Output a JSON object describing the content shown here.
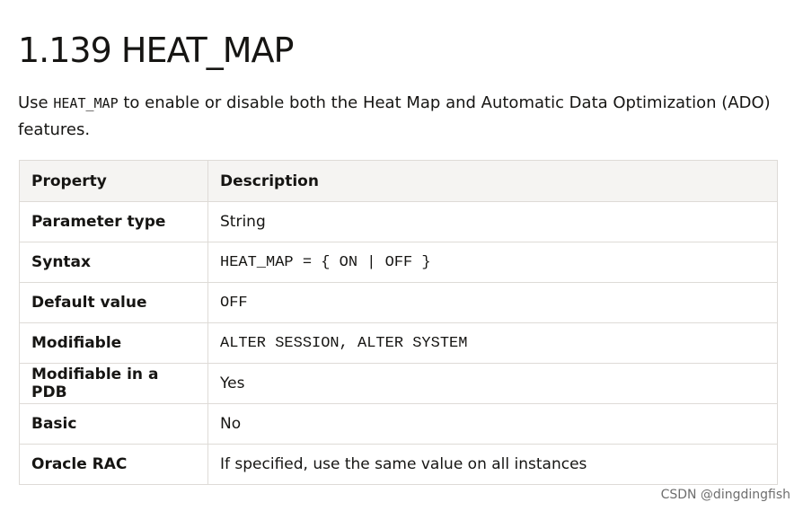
{
  "page_title": "1.139 HEAT_MAP",
  "intro": {
    "prefix": "Use ",
    "code": "HEAT_MAP",
    "suffix": " to enable or disable both the Heat Map and Automatic Data Optimization (ADO) features."
  },
  "table": {
    "headers": [
      "Property",
      "Description"
    ],
    "rows": [
      {
        "property": "Parameter type",
        "description": "String",
        "mono": false
      },
      {
        "property": "Syntax",
        "description": "HEAT_MAP = { ON | OFF }",
        "mono": true
      },
      {
        "property": "Default value",
        "description": "OFF",
        "mono": true
      },
      {
        "property": "Modifiable",
        "description": "ALTER SESSION, ALTER SYSTEM",
        "mono": true
      },
      {
        "property": "Modifiable in a PDB",
        "description": "Yes",
        "mono": false
      },
      {
        "property": "Basic",
        "description": "No",
        "mono": false
      },
      {
        "property": "Oracle RAC",
        "description": "If specified, use the same value on all instances",
        "mono": false
      }
    ]
  },
  "watermark": "CSDN @dingdingfish"
}
